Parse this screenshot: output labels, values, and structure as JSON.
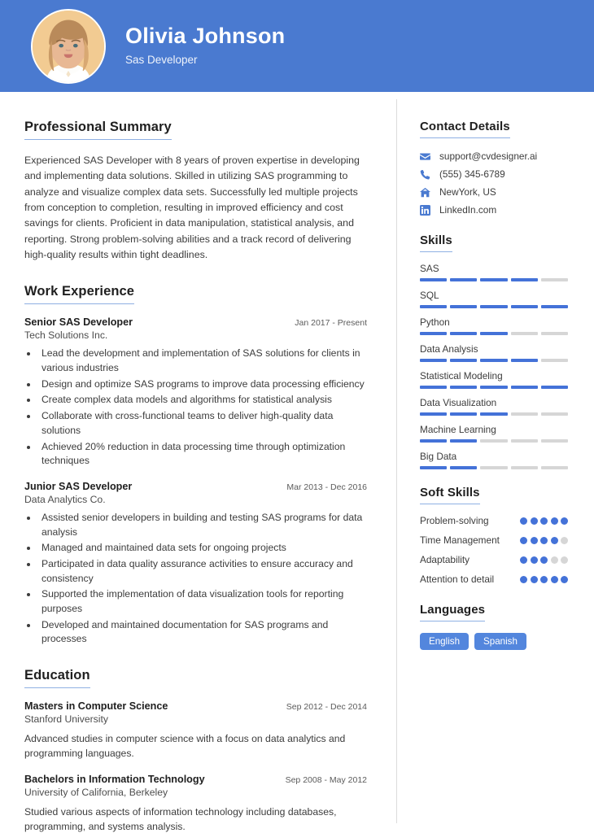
{
  "header": {
    "name": "Olivia Johnson",
    "job_title": "Sas Developer",
    "background_color": "#4a7ad0",
    "avatar_name": "profile-photo"
  },
  "accent_color": "#4472d8",
  "summary": {
    "title": "Professional Summary",
    "text": "Experienced SAS Developer with 8 years of proven expertise in developing and implementing data solutions. Skilled in utilizing SAS programming to analyze and visualize complex data sets. Successfully led multiple projects from conception to completion, resulting in improved efficiency and cost savings for clients. Proficient in data manipulation, statistical analysis, and reporting. Strong problem-solving abilities and a track record of delivering high-quality results within tight deadlines."
  },
  "experience": {
    "title": "Work Experience",
    "jobs": [
      {
        "role": "Senior SAS Developer",
        "date": "Jan 2017 - Present",
        "company": "Tech Solutions Inc.",
        "bullets": [
          "Lead the development and implementation of SAS solutions for clients in various industries",
          "Design and optimize SAS programs to improve data processing efficiency",
          "Create complex data models and algorithms for statistical analysis",
          "Collaborate with cross-functional teams to deliver high-quality data solutions",
          "Achieved 20% reduction in data processing time through optimization techniques"
        ]
      },
      {
        "role": "Junior SAS Developer",
        "date": "Mar 2013 - Dec 2016",
        "company": "Data Analytics Co.",
        "bullets": [
          "Assisted senior developers in building and testing SAS programs for data analysis",
          "Managed and maintained data sets for ongoing projects",
          "Participated in data quality assurance activities to ensure accuracy and consistency",
          "Supported the implementation of data visualization tools for reporting purposes",
          "Developed and maintained documentation for SAS programs and processes"
        ]
      }
    ]
  },
  "education": {
    "title": "Education",
    "items": [
      {
        "degree": "Masters in Computer Science",
        "date": "Sep 2012 - Dec 2014",
        "school": "Stanford University",
        "description": "Advanced studies in computer science with a focus on data analytics and programming languages."
      },
      {
        "degree": "Bachelors in Information Technology",
        "date": "Sep 2008 - May 2012",
        "school": "University of California, Berkeley",
        "description": "Studied various aspects of information technology including databases, programming, and systems analysis."
      }
    ]
  },
  "contact": {
    "title": "Contact Details",
    "items": [
      {
        "icon": "envelope-icon",
        "value": "support@cvdesigner.ai"
      },
      {
        "icon": "phone-icon",
        "value": "(555) 345-6789"
      },
      {
        "icon": "home-icon",
        "value": "NewYork, US"
      },
      {
        "icon": "linkedin-icon",
        "value": "LinkedIn.com"
      }
    ]
  },
  "skills": {
    "title": "Skills",
    "max": 5,
    "items": [
      {
        "name": "SAS",
        "level": 4
      },
      {
        "name": "SQL",
        "level": 5
      },
      {
        "name": "Python",
        "level": 3
      },
      {
        "name": "Data Analysis",
        "level": 4
      },
      {
        "name": "Statistical Modeling",
        "level": 5
      },
      {
        "name": "Data Visualization",
        "level": 3
      },
      {
        "name": "Machine Learning",
        "level": 2
      },
      {
        "name": "Big Data",
        "level": 2
      }
    ]
  },
  "soft_skills": {
    "title": "Soft Skills",
    "max": 5,
    "items": [
      {
        "name": "Problem-solving",
        "level": 5
      },
      {
        "name": "Time Management",
        "level": 4
      },
      {
        "name": "Adaptability",
        "level": 3
      },
      {
        "name": "Attention to detail",
        "level": 5
      }
    ]
  },
  "languages": {
    "title": "Languages",
    "items": [
      "English",
      "Spanish"
    ]
  }
}
